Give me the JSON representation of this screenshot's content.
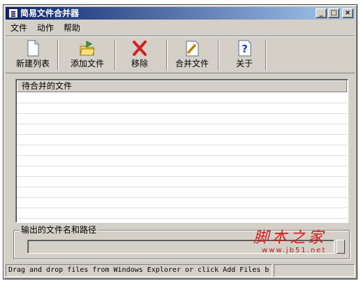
{
  "window": {
    "title": "简易文件合并器",
    "controls": {
      "minimize": "_",
      "maximize": "□",
      "close": "×"
    }
  },
  "menu": {
    "items": [
      "文件",
      "动作",
      "帮助"
    ]
  },
  "toolbar": {
    "buttons": [
      {
        "label": "新建列表",
        "icon": "new-document-icon"
      },
      {
        "label": "添加文件",
        "icon": "add-folder-icon"
      },
      {
        "label": "移除",
        "icon": "remove-x-icon"
      },
      {
        "label": "合并文件",
        "icon": "merge-files-icon"
      },
      {
        "label": "关于",
        "icon": "help-about-icon"
      }
    ]
  },
  "list": {
    "column_header": "待合并的文件",
    "rows": []
  },
  "output": {
    "group_label": "输出的文件名和路径",
    "path_value": ""
  },
  "status": {
    "text": "Drag and drop files from Windows Explorer or click Add Files b"
  },
  "watermark": {
    "text": "脚本之家",
    "url": "www.jb51.net"
  },
  "colors": {
    "title_start": "#0a246a",
    "title_end": "#a6caf0",
    "face": "#d4d0c8",
    "remove_red": "#d42020",
    "watermark_red": "#d21d1d"
  }
}
